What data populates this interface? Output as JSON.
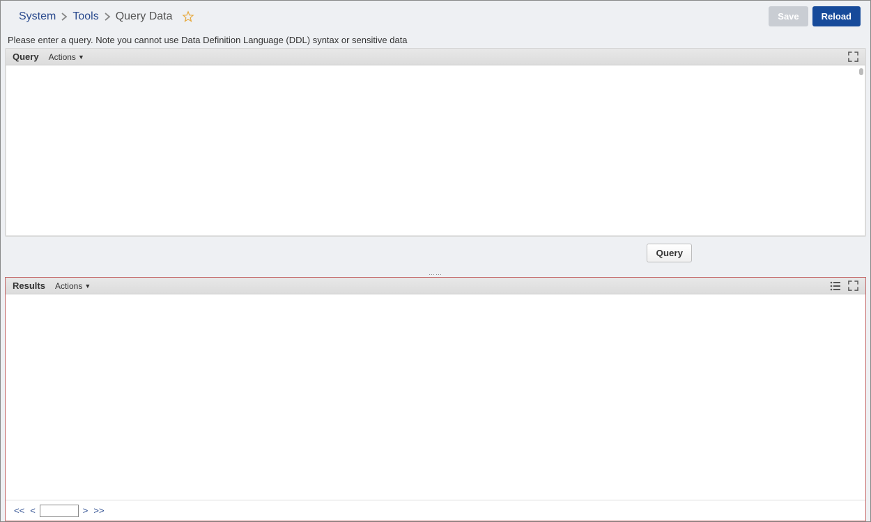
{
  "breadcrumbs": {
    "items": [
      {
        "label": "System",
        "link": true
      },
      {
        "label": "Tools",
        "link": true
      },
      {
        "label": "Query Data",
        "link": false
      }
    ]
  },
  "topbar": {
    "save_label": "Save",
    "reload_label": "Reload"
  },
  "instruction_text": "Please enter a query. Note you cannot use Data Definition Language (DDL) syntax or sensitive data",
  "query_panel": {
    "title": "Query",
    "actions_label": "Actions",
    "textarea_value": "",
    "textarea_placeholder": ""
  },
  "run_button_label": "Query",
  "splitter_dots": "……",
  "results_panel": {
    "title": "Results",
    "actions_label": "Actions"
  },
  "pager": {
    "first": "<<",
    "prev": "<",
    "page_value": "",
    "next": ">",
    "last": ">>"
  }
}
